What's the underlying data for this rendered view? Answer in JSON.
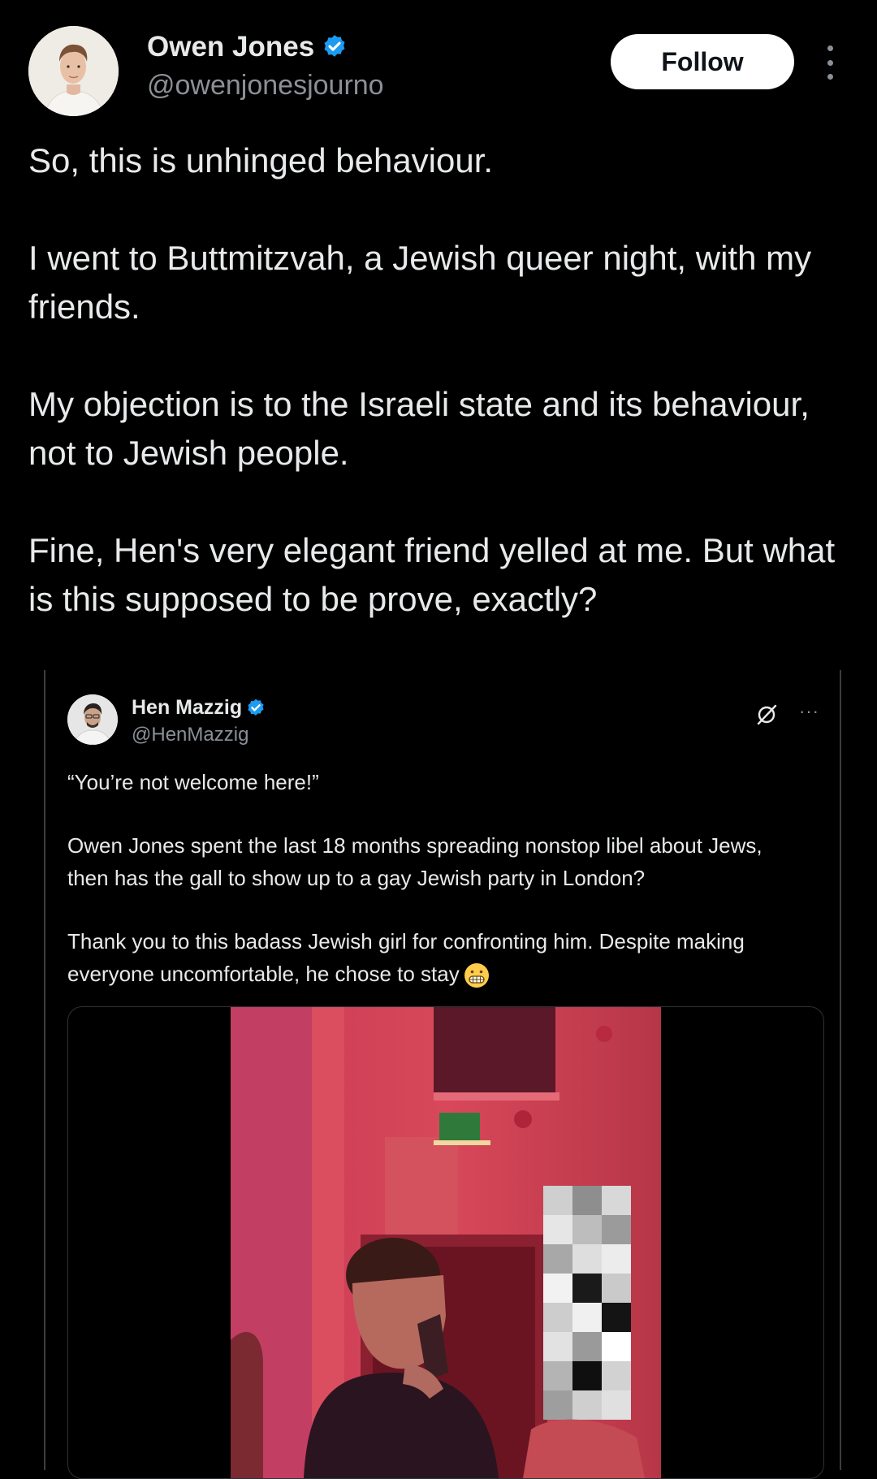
{
  "author": {
    "name": "Owen Jones",
    "handle": "@owenjonesjourno",
    "verified_icon": "verified-badge-icon",
    "avatar_icon": "avatar"
  },
  "actions": {
    "follow_label": "Follow",
    "more_icon": "more-vertical-icon"
  },
  "tweet": {
    "paragraphs": [
      "So, this is unhinged behaviour.",
      "I went to Buttmitzvah, a Jewish queer night, with my friends.",
      "My objection is to the Israeli state and its behaviour, not to Jewish people.",
      "Fine, Hen's very elegant friend yelled at me. But what is this supposed to be prove, exactly?"
    ]
  },
  "quote": {
    "name": "Hen Mazzig",
    "handle": "@HenMazzig",
    "grok_icon": "grok-icon",
    "more_label": "···",
    "paragraphs": [
      "“You’re not welcome here!”",
      "Owen Jones spent the last 18 months spreading nonstop libel about Jews, then has the gall to show up to a gay Jewish party in London?",
      "Thank you to this badass Jewish girl for confronting him. Despite making everyone uncomfortable, he chose to stay"
    ],
    "emoji_icon": "grimacing-face-icon",
    "media": "video-still"
  },
  "colors": {
    "background": "#000000",
    "text": "#e7e9ea",
    "secondary_text": "#8b9096",
    "verified_blue": "#1d9bf0",
    "follow_bg": "#ffffff"
  }
}
